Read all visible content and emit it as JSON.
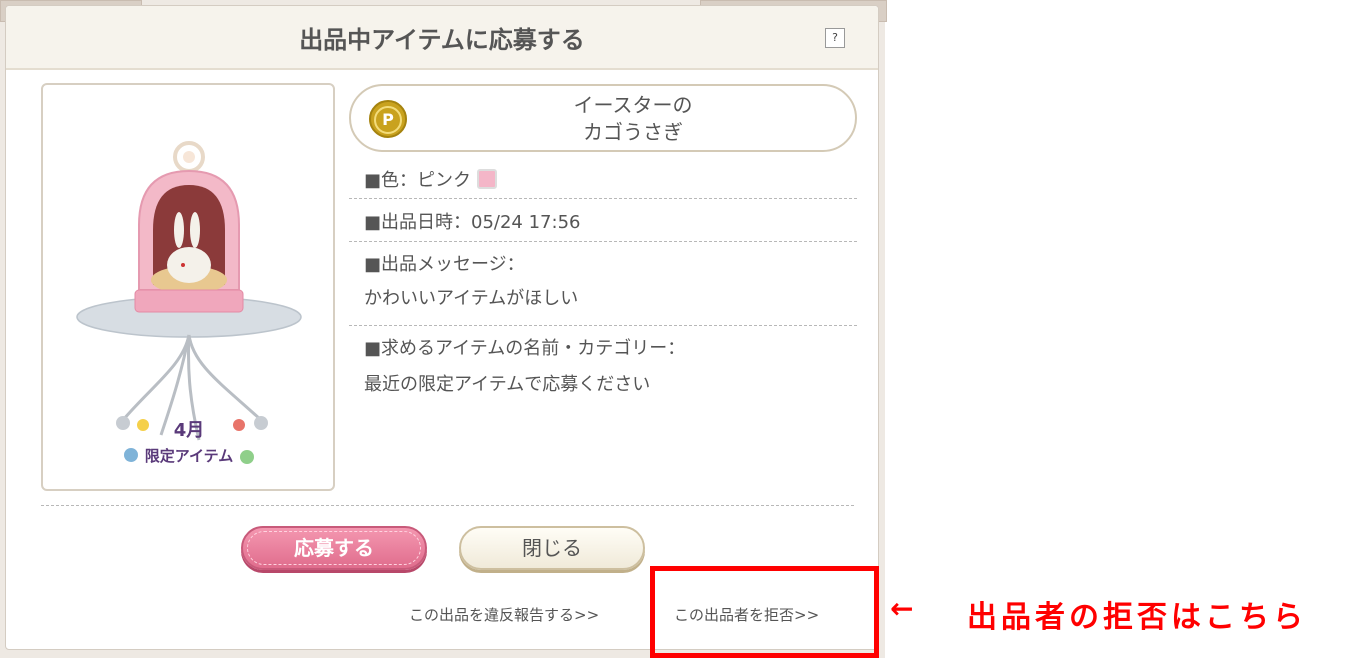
{
  "dialog": {
    "title": "出品中アイテムに応募する",
    "help_label": "?"
  },
  "item": {
    "currency_icon": "P",
    "name_line1": "イースターの",
    "name_line2": "カゴうさぎ",
    "image_caption_line1": "4月",
    "image_caption_line2": "限定アイテム"
  },
  "details": {
    "color_label": "■色：ピンク",
    "color_swatch": "#f4b6c8",
    "listed_at": "■出品日時：05/24 17:56",
    "message_label": "■出品メッセージ：",
    "message_text": "かわいいアイテムがほしい",
    "wanted_label": "■求めるアイテムの名前・カテゴリー：",
    "wanted_text": "最近の限定アイテムで応募ください"
  },
  "buttons": {
    "apply_label": "応募する",
    "close_label": "閉じる"
  },
  "links": {
    "report_label": "この出品を違反報告する>>",
    "reject_label": "この出品者を拒否>>"
  },
  "annotation": {
    "arrow": "←",
    "text": "出品者の拒否はこちら"
  },
  "colors": {
    "accent_pink": "#e06d8d",
    "highlight_red": "#ff0000"
  }
}
